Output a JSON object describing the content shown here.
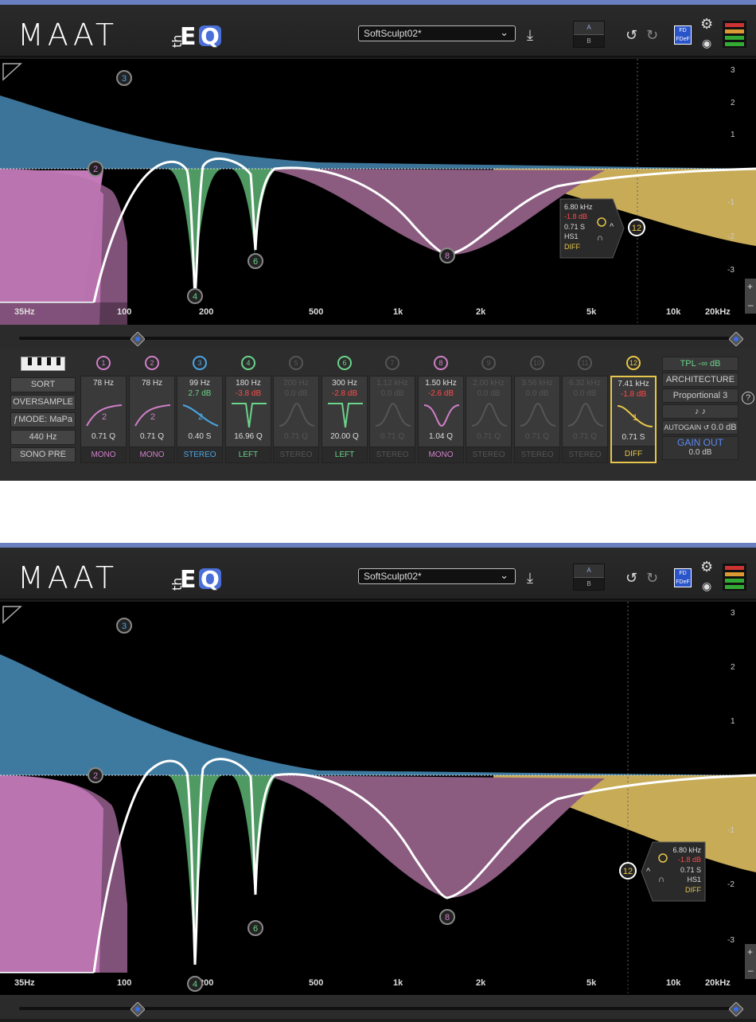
{
  "header": {
    "logo": "MAAT",
    "product": "thEQ",
    "preset": "SoftSculpt02*",
    "ab_a": "A",
    "ab_b": "B",
    "fdfdef": "FD FDeF"
  },
  "graph": {
    "db_ticks": [
      "3",
      "2",
      "1",
      "-1",
      "-2",
      "-3"
    ],
    "hz_ticks": [
      "35Hz",
      "100",
      "200",
      "500",
      "1k",
      "2k",
      "5k",
      "10k",
      "20kHz"
    ],
    "node_labels": [
      "3",
      "2",
      "4",
      "6",
      "8",
      "12"
    ],
    "tooltip": {
      "freq": "6.80 kHz",
      "gain": "-1.8 dB",
      "q": "0.71 S",
      "type": "HS1",
      "mode": "DIFF"
    }
  },
  "left_buttons": [
    "SORT",
    "OVERSAMPLE",
    "ƒMODE: MaPa",
    "440 Hz",
    "SONO PRE"
  ],
  "bands": [
    {
      "num": "1",
      "freq": "78 Hz",
      "gain": "",
      "q": "0.71 Q",
      "ch": "MONO",
      "label": "2"
    },
    {
      "num": "2",
      "freq": "78 Hz",
      "gain": "",
      "q": "0.71 Q",
      "ch": "MONO",
      "label": "2"
    },
    {
      "num": "3",
      "freq": "99 Hz",
      "gain": "2.7 dB",
      "q": "0.40 S",
      "ch": "STEREO",
      "label": "2"
    },
    {
      "num": "4",
      "freq": "180 Hz",
      "gain": "-3.8 dB",
      "q": "16.96 Q",
      "ch": "LEFT",
      "label": ""
    },
    {
      "num": "5",
      "freq": "200 Hz",
      "gain": "0.0 dB",
      "q": "0.71 Q",
      "ch": "STEREO",
      "label": ""
    },
    {
      "num": "6",
      "freq": "300 Hz",
      "gain": "-2.8 dB",
      "q": "20.00 Q",
      "ch": "LEFT",
      "label": ""
    },
    {
      "num": "7",
      "freq": "1.12 kHz",
      "gain": "0.0 dB",
      "q": "0.71 Q",
      "ch": "STEREO",
      "label": ""
    },
    {
      "num": "8",
      "freq": "1.50 kHz",
      "gain": "-2.6 dB",
      "q": "1.04 Q",
      "ch": "MONO",
      "label": ""
    },
    {
      "num": "9",
      "freq": "2.00 kHz",
      "gain": "0.0 dB",
      "q": "0.71 Q",
      "ch": "STEREO",
      "label": ""
    },
    {
      "num": "10",
      "freq": "3.56 kHz",
      "gain": "0.0 dB",
      "q": "0.71 Q",
      "ch": "STEREO",
      "label": ""
    },
    {
      "num": "11",
      "freq": "6.32 kHz",
      "gain": "0.0 dB",
      "q": "0.71 Q",
      "ch": "STEREO",
      "label": ""
    },
    {
      "num": "12",
      "freq": "7.41 kHz",
      "gain": "-1.8 dB",
      "q": "0.71 S",
      "ch": "DIFF",
      "label": "1"
    }
  ],
  "right_panel": {
    "tpl": "TPL -∞ dB",
    "architecture": "ARCHITECTURE",
    "proportional": "Proportional 3",
    "autogain": "AUTOGAIN",
    "autogain_val": "0.0 dB",
    "gain_out": "GAIN OUT",
    "gain_out_val": "0.0 dB",
    "help": "?"
  },
  "colors": {
    "pink": "#d07fc8",
    "blue": "#4aa6e6",
    "green": "#6bd38a",
    "purple": "#8a5a7e",
    "gold": "#e6c64a",
    "red": "#ff4a4a"
  }
}
